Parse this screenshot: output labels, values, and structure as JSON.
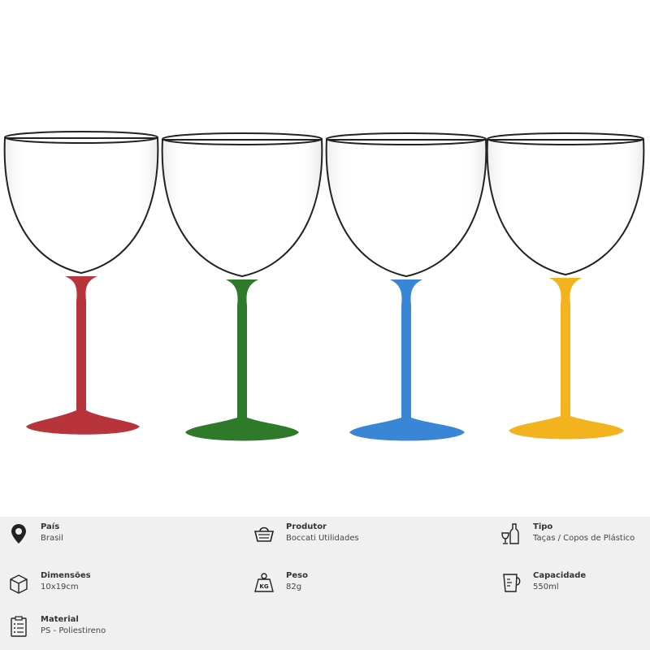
{
  "glasses": [
    {
      "name": "red",
      "color": "#b8343b"
    },
    {
      "name": "green",
      "color": "#2f7a2a"
    },
    {
      "name": "blue",
      "color": "#3a86d6"
    },
    {
      "name": "yellow",
      "color": "#f2b31e"
    }
  ],
  "specs": {
    "pais": {
      "label": "País",
      "value": "Brasil",
      "icon": "location-pin-icon"
    },
    "produtor": {
      "label": "Produtor",
      "value": "Boccati Utilidades",
      "icon": "basket-icon"
    },
    "tipo": {
      "label": "Tipo",
      "value": "Taças / Copos de Plástico",
      "icon": "wine-bottle-glass-icon"
    },
    "dimensoes": {
      "label": "Dimensões",
      "value": "10x19cm",
      "icon": "box-dimensions-icon"
    },
    "peso": {
      "label": "Peso",
      "value": "82g",
      "icon": "weight-kg-icon"
    },
    "peso_icon_text": "KG",
    "capacidade": {
      "label": "Capacidade",
      "value": "550ml",
      "icon": "measuring-cup-icon"
    },
    "material": {
      "label": "Material",
      "value": "PS - Poliestireno",
      "icon": "clipboard-list-icon"
    }
  }
}
